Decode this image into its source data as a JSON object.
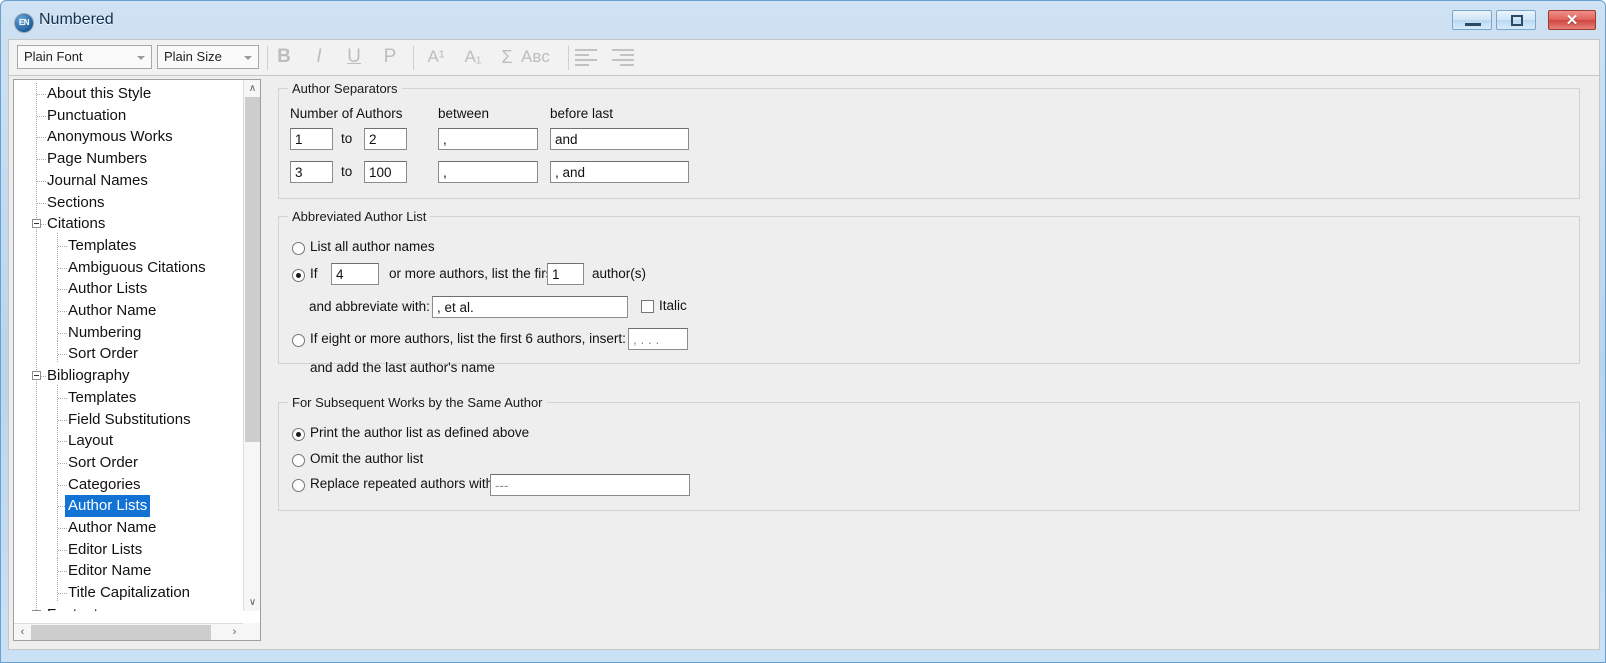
{
  "window": {
    "title": "Numbered",
    "icon": "EN",
    "minimize_label": "Minimize",
    "maximize_label": "Maximize",
    "close_label": "✕"
  },
  "toolbar": {
    "font_combo": "Plain Font",
    "size_combo": "Plain Size",
    "bold": "B",
    "italic": "I",
    "underline": "U",
    "plain": "P",
    "superscript": "A¹",
    "subscript": "A₁",
    "symbol": "Σ",
    "smallcaps": "Aʙᴄ",
    "align_left": "align-left",
    "align_right": "align-right"
  },
  "sidebar": {
    "items": [
      {
        "label": "About this Style",
        "level": 1,
        "expander": false
      },
      {
        "label": "Punctuation",
        "level": 1,
        "expander": false
      },
      {
        "label": "Anonymous Works",
        "level": 1,
        "expander": false
      },
      {
        "label": "Page Numbers",
        "level": 1,
        "expander": false
      },
      {
        "label": "Journal Names",
        "level": 1,
        "expander": false
      },
      {
        "label": "Sections",
        "level": 1,
        "expander": false
      },
      {
        "label": "Citations",
        "level": 1,
        "expander": true
      },
      {
        "label": "Templates",
        "level": 2,
        "expander": false
      },
      {
        "label": "Ambiguous Citations",
        "level": 2,
        "expander": false
      },
      {
        "label": "Author Lists",
        "level": 2,
        "expander": false
      },
      {
        "label": "Author Name",
        "level": 2,
        "expander": false
      },
      {
        "label": "Numbering",
        "level": 2,
        "expander": false
      },
      {
        "label": "Sort Order",
        "level": 2,
        "expander": false
      },
      {
        "label": "Bibliography",
        "level": 1,
        "expander": true
      },
      {
        "label": "Templates",
        "level": 2,
        "expander": false
      },
      {
        "label": "Field Substitutions",
        "level": 2,
        "expander": false
      },
      {
        "label": "Layout",
        "level": 2,
        "expander": false
      },
      {
        "label": "Sort Order",
        "level": 2,
        "expander": false
      },
      {
        "label": "Categories",
        "level": 2,
        "expander": false
      },
      {
        "label": "Author Lists",
        "level": 2,
        "expander": false,
        "selected": true
      },
      {
        "label": "Author Name",
        "level": 2,
        "expander": false
      },
      {
        "label": "Editor Lists",
        "level": 2,
        "expander": false
      },
      {
        "label": "Editor Name",
        "level": 2,
        "expander": false
      },
      {
        "label": "Title Capitalization",
        "level": 2,
        "expander": false
      },
      {
        "label": "Footnotes",
        "level": 1,
        "expander": true
      }
    ],
    "scroll_up": "∧",
    "scroll_down": "∨",
    "scroll_left": "‹",
    "scroll_right": "›"
  },
  "author_separators": {
    "title": "Author Separators",
    "col_number": "Number of Authors",
    "col_between": "between",
    "col_before_last": "before last",
    "to_label_1": "to",
    "to_label_2": "to",
    "rows": [
      {
        "from": "1",
        "to": "2",
        "between": ",",
        "before_last": "and"
      },
      {
        "from": "3",
        "to": "100",
        "between": ",",
        "before_last": ", and"
      }
    ]
  },
  "abbreviated_author_list": {
    "title": "Abbreviated Author List",
    "option_list_all": "List all author names",
    "option_if_prefix": "If",
    "threshold_value": "4",
    "option_if_mid": "or more authors, list the first",
    "first_count_value": "1",
    "option_if_suffix": "author(s)",
    "abbreviate_label": "and abbreviate with:",
    "abbreviate_value": ", et al.",
    "italic_label": "Italic",
    "option_eight": "If eight or more authors, list the first 6 authors, insert:",
    "insert_value": ", . . .",
    "option_eight_line2": "and add the last author's name",
    "selected": "if_n_or_more"
  },
  "subsequent_works": {
    "title": "For Subsequent Works by the Same Author",
    "option_print": "Print the author list as defined above",
    "option_omit": "Omit the author list",
    "option_replace": "Replace repeated authors with:",
    "replace_value": "---",
    "selected": "print"
  },
  "colors": {
    "selection": "#1273d5",
    "title_text": "#15304a",
    "close_button": "#cf463e"
  }
}
